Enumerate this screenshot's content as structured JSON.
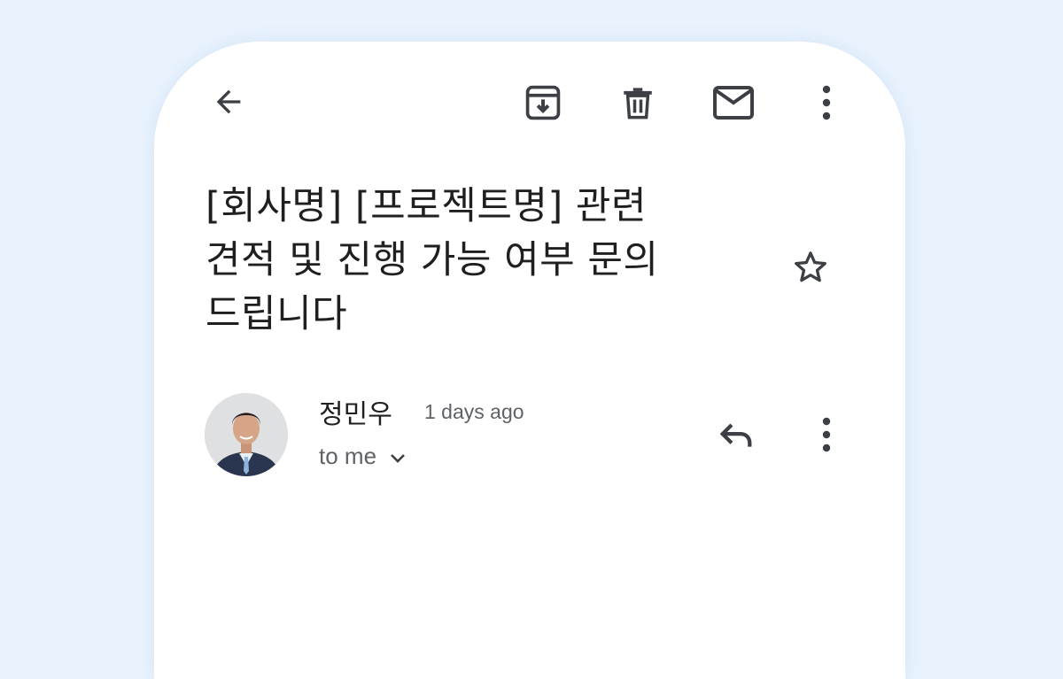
{
  "colors": {
    "background": "#e9f3fe",
    "card": "#ffffff",
    "icon": "#3c3f44",
    "text_primary": "#1f1f1f",
    "text_secondary": "#5f6368"
  },
  "toolbar": {
    "icons": [
      "back-arrow-icon",
      "archive-icon",
      "trash-icon",
      "mail-icon",
      "more-vert-icon"
    ]
  },
  "email": {
    "subject_lines": [
      "[회사명] [프로젝트명] 관련",
      "견적 및 진행 가능 여부 문의",
      "드립니다"
    ],
    "starred": false,
    "sender": {
      "name": "정민우",
      "time": "1 days ago",
      "recipient": "to me"
    }
  }
}
